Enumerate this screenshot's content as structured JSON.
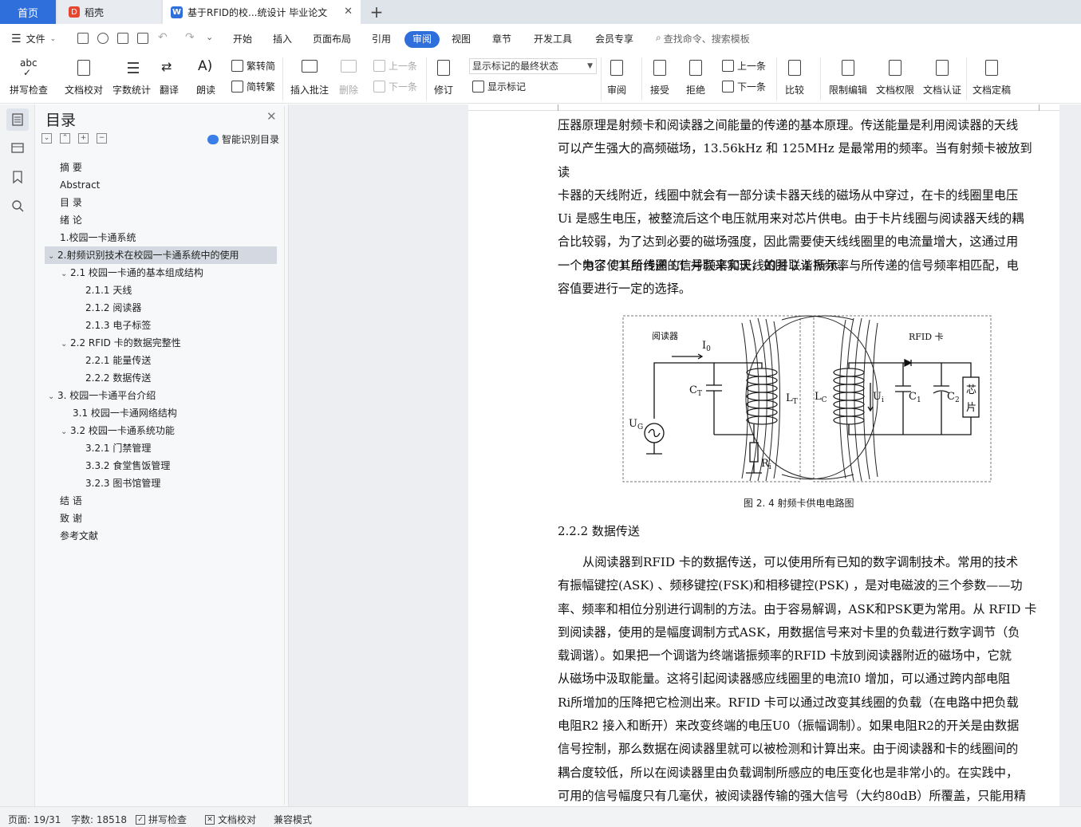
{
  "tabs": {
    "home": "首页",
    "daoke": "稻壳",
    "doc": "基于RFID的校...统设计 毕业论文"
  },
  "menu": {
    "file": "文件",
    "items": [
      "开始",
      "插入",
      "页面布局",
      "引用",
      "审阅",
      "视图",
      "章节",
      "开发工具",
      "会员专享"
    ],
    "active": "审阅",
    "search": "查找命令、搜索模板"
  },
  "ribbon": {
    "spell": "拼写检查",
    "proof": "文档校对",
    "wordcount": "字数统计",
    "translate": "翻译",
    "read": "朗读",
    "trad": "繁转简",
    "simp": "简转繁",
    "comment": "插入批注",
    "delete": "删除",
    "prev": "上一条",
    "next": "下一条",
    "revise": "修订",
    "markup_state": "显示标记的最终状态",
    "show_markup": "显示标记",
    "review": "审阅",
    "accept": "接受",
    "reject": "拒绝",
    "prev2": "上一条",
    "next2": "下一条",
    "compare": "比较",
    "restrict": "限制编辑",
    "perm": "文档权限",
    "cert": "文档认证",
    "final": "文档定稿"
  },
  "toc": {
    "title": "目录",
    "smart": "智能识别目录",
    "items": [
      "摘  要",
      "Abstract",
      "目  录",
      "绪  论",
      "1.校园一卡通系统",
      "2.射频识别技术在校园一卡通系统中的使用",
      "2.1 校园一卡通的基本组成结构",
      "2.1.1 天线",
      "2.1.2  阅读器",
      "2.1.3  电子标签",
      "2.2 RFID 卡的数据完整性",
      "2.2.1  能量传送",
      "2.2.2  数据传送",
      "3.  校园一卡通平台介绍",
      "3.1 校园一卡通网络结构",
      "3.2 校园一卡通系统功能",
      "3.2.1 门禁管理",
      "3.3.2 食堂售饭管理",
      "3.2.3 图书馆管理",
      "结  语",
      "致    谢",
      "参考文献"
    ]
  },
  "doc": {
    "p1_lines": [
      "压器原理是射频卡和阅读器之间能量的传递的基本原理。传送能量是利用阅读器的天线",
      "可以产生强大的高频磁场，13.56kHz 和 125MHz 是最常用的频率。当有射频卡被放到读",
      "卡器的天线附近，线圈中就会有一部分读卡器天线的磁场从中穿过，在卡的线圈里电压",
      "Ui 是感生电压，被整流后这个电压就用来对芯片供电。由于卡片线圈与阅读器天线的耦",
      "合比较弱，为了达到必要的磁场强度，因此需要使天线线圈里的电流量增大，这通过用",
      "一个电容 CT 给线圈 LT 并联来实现，如图 2.4 所示。"
    ],
    "p2_lines": [
      "为了使其所传递的信号频率和天线的并联谐振频率与所传递的信号频率相匹配，电",
      "容值要进行一定的选择。"
    ],
    "figure": {
      "reader": "阅读器",
      "card": "RFID 卡",
      "I0": "I",
      "I0_sub": "0",
      "CT": "C",
      "CT_sub": "T",
      "LT": "L",
      "LT_sub": "T",
      "LC": "L",
      "LC_sub": "C",
      "UG": "U",
      "UG_sub": "G",
      "Ri": "R",
      "Ri_sub": "i",
      "Ui": "U",
      "Ui_sub": "i",
      "C1": "C",
      "C1_sub": "1",
      "C2": "C",
      "C2_sub": "2",
      "chip1": "芯",
      "chip2": "片"
    },
    "caption": "图 2. 4 射频卡供电电路图",
    "heading": "2.2.2  数据传送",
    "p3_lines": [
      "从阅读器到RFID 卡的数据传送，可以使用所有已知的数字调制技术。常用的技术",
      "有振幅键控(ASK) 、频移键控(FSK)和相移键控(PSK) ，是对电磁波的三个参数——功",
      "率、频率和相位分别进行调制的方法。由于容易解调，ASK和PSK更为常用。从  RFID 卡",
      "到阅读器，使用的是幅度调制方式ASK，用数据信号来对卡里的负载进行数字调节（负",
      "载调谐）。如果把一个调谐为终端谐振频率的RFID 卡放到阅读器附近的磁场中，它就",
      "从磁场中汲取能量。这将引起阅读器感应线圈里的电流I0  增加，可以通过跨内部电阻",
      "Ri所增加的压降把它检测出来。RFID 卡可以通过改变其线圈的负载（在电路中把负载",
      "电阻R2 接入和断开）来改变终端的电压U0（振幅调制）。如果电阻R2的开关是由数据",
      "信号控制，那么数据在阅读器里就可以被检测和计算出来。由于阅读器和卡的线圈间的",
      "耦合度较低，所以在阅读器里由负载调制所感应的电压变化也是非常小的。在实践中，",
      "可用的信号幅度只有几毫伏，被阅读器传输的强大信号（大约80dB）所覆盖，只能用精"
    ]
  },
  "status": {
    "page": "页面: 19/31",
    "words": "字数: 18518",
    "spell": "拼写检查",
    "proof": "文档校对",
    "compat": "兼容模式"
  }
}
